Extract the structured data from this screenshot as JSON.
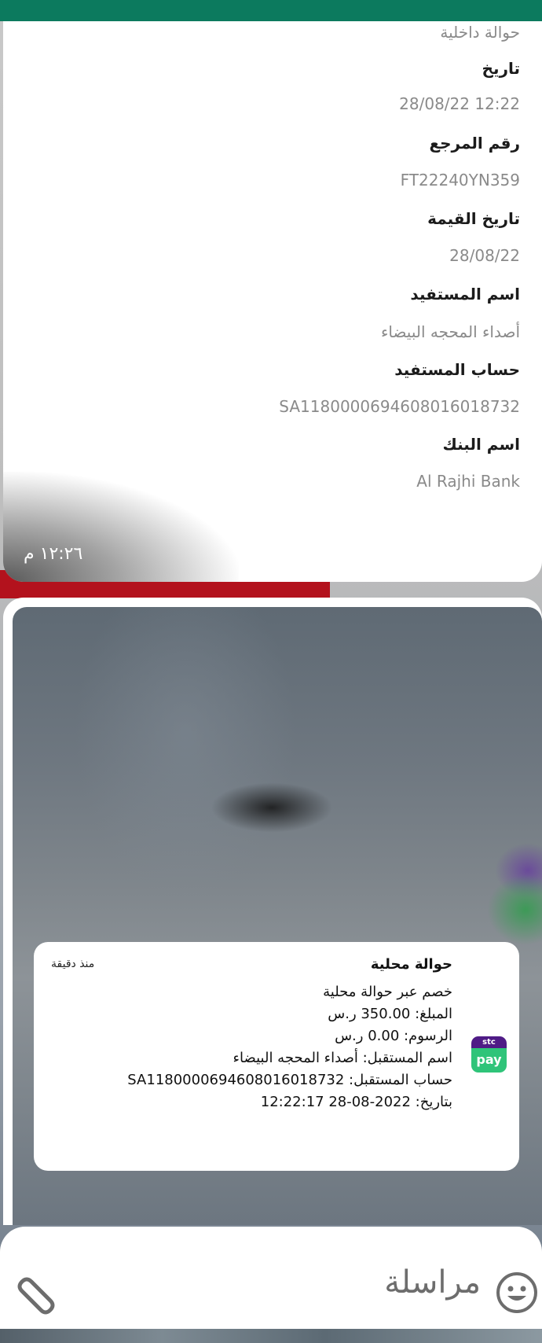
{
  "first_message": {
    "rows": [
      {
        "value": "حوالة داخلية",
        "ar": true
      },
      {
        "title": "تاريخ",
        "value": "28/08/22 12:22"
      },
      {
        "title": "رقم المرجع",
        "value": "FT22240YN359"
      },
      {
        "title": "تاريخ القيمة",
        "value": "28/08/22"
      },
      {
        "title": "اسم المستفيد",
        "value": "أصداء المحجه البيضاء",
        "ar": true
      },
      {
        "title": "حساب المستفيد",
        "value": "SA1180000694608016018732"
      },
      {
        "title": "اسم البنك",
        "value": "Al Rajhi Bank"
      }
    ],
    "time": "١٢:٢٦ م"
  },
  "notification": {
    "title": "حوالة محلية",
    "time_ago": "منذ دقيقة",
    "lines": [
      "خصم  عبر حوالة محلية",
      "المبلغ: 350.00 ر.س",
      "الرسوم: 0.00 ر.س",
      "اسم المستقبل: أصداء المحجه البيضاء",
      "حساب المستقبل: SA1180000694608016018732",
      "بتاريخ: 2022-08-28 12:22:17"
    ],
    "app_icon": {
      "top": "stc",
      "bottom": "pay",
      "colors": {
        "top": "#4f1b86",
        "bottom": "#2fc479"
      }
    }
  },
  "composer": {
    "placeholder": "مراسلة",
    "icons": [
      "emoji-icon",
      "attach-icon"
    ]
  },
  "colors": {
    "header": "#0c7a5e"
  }
}
